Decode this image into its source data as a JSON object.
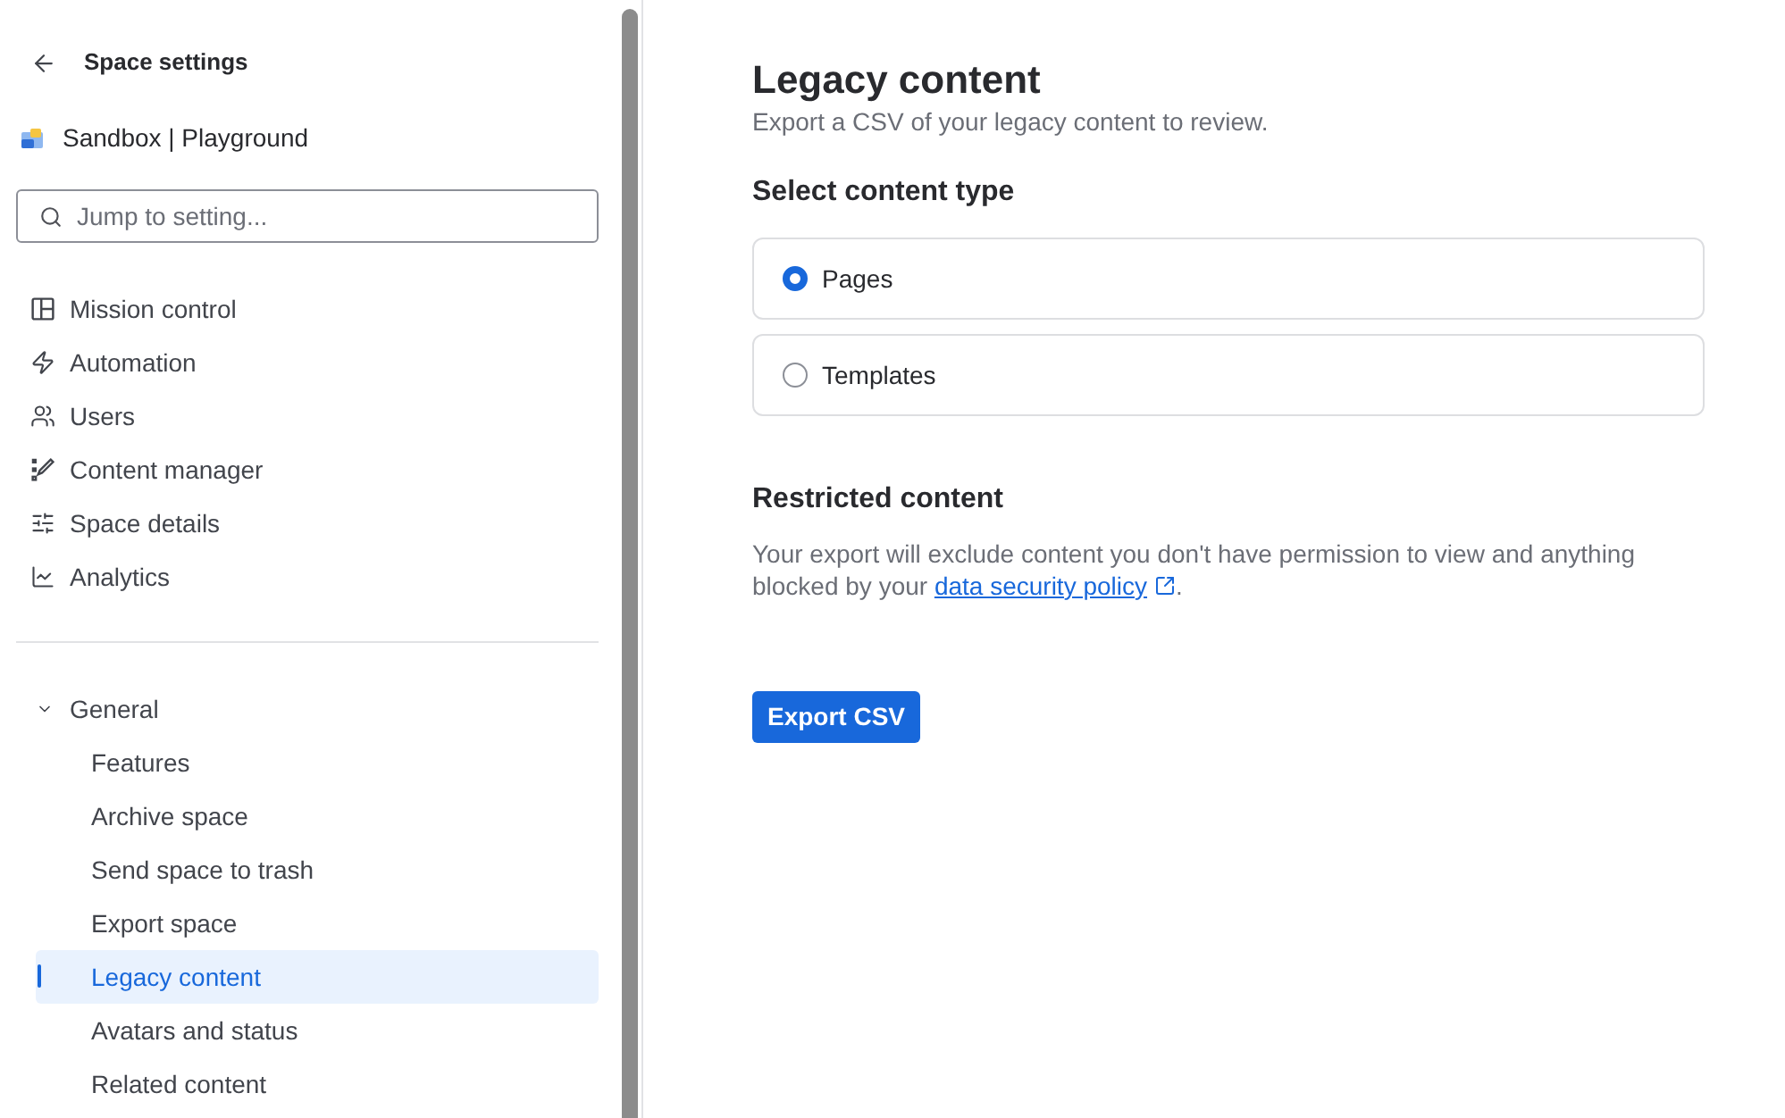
{
  "header": {
    "title": "Space settings"
  },
  "space": {
    "name": "Sandbox | Playground"
  },
  "search": {
    "placeholder": "Jump to setting..."
  },
  "nav_items": [
    {
      "label": "Mission control"
    },
    {
      "label": "Automation"
    },
    {
      "label": "Users"
    },
    {
      "label": "Content manager"
    },
    {
      "label": "Space details"
    },
    {
      "label": "Analytics"
    }
  ],
  "section": {
    "label": "General",
    "expanded": true,
    "children": [
      {
        "label": "Features",
        "selected": false
      },
      {
        "label": "Archive space",
        "selected": false
      },
      {
        "label": "Send space to trash",
        "selected": false
      },
      {
        "label": "Export space",
        "selected": false
      },
      {
        "label": "Legacy content",
        "selected": true
      },
      {
        "label": "Avatars and status",
        "selected": false
      },
      {
        "label": "Related content",
        "selected": false
      }
    ]
  },
  "main": {
    "title": "Legacy content",
    "subtitle": "Export a CSV of your legacy content to review.",
    "content_type": {
      "heading": "Select content type",
      "options": [
        {
          "label": "Pages",
          "selected": true
        },
        {
          "label": "Templates",
          "selected": false
        }
      ]
    },
    "restricted": {
      "heading": "Restricted content",
      "text_before": "Your export will exclude content you don't have permission to view and anything blocked by your ",
      "link": "data security policy",
      "text_after": "."
    },
    "button": "Export CSV"
  }
}
